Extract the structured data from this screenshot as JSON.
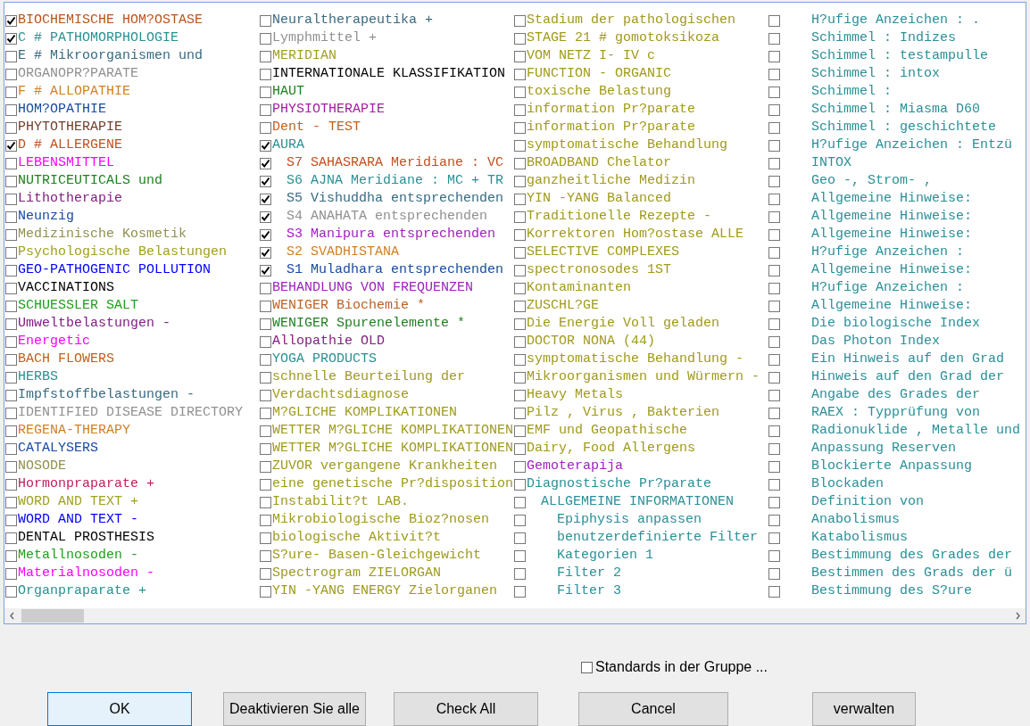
{
  "list": {
    "items": [
      {
        "text": "BIOCHEMISCHE HOM?OSTASE",
        "checked": true,
        "color": "#b8541a"
      },
      {
        "text": "C # PATHOMORPHOLOGIE",
        "checked": true,
        "color": "#2a9090"
      },
      {
        "text": "E # Mikroorganismen und",
        "checked": false,
        "color": "#3a6a80"
      },
      {
        "text": "ORGANOPR?PARATE",
        "checked": false,
        "color": "#909090"
      },
      {
        "text": "F # ALLOPATHIE",
        "checked": false,
        "color": "#d08020"
      },
      {
        "text": "HOM?OPATHIE",
        "checked": false,
        "color": "#1a4aa0"
      },
      {
        "text": "PHYTOTHERAPIE",
        "checked": false,
        "color": "#704030"
      },
      {
        "text": "D # ALLERGENE",
        "checked": true,
        "color": "#c05020"
      },
      {
        "text": "LEBENSMITTEL",
        "checked": false,
        "color": "#ff00ff"
      },
      {
        "text": "NUTRICEUTICALS und",
        "checked": false,
        "color": "#208020"
      },
      {
        "text": "Lithotherapie",
        "checked": false,
        "color": "#802080"
      },
      {
        "text": "Neunzig",
        "checked": false,
        "color": "#1a4aa1"
      },
      {
        "text": "Medizinische Kosmetik",
        "checked": false,
        "color": "#909050"
      },
      {
        "text": "Psychologische Belastungen",
        "checked": false,
        "color": "#a0a020"
      },
      {
        "text": "GEO-PATHOGENIC POLLUTION",
        "checked": false,
        "color": "#0000ff"
      },
      {
        "text": "VACCINATIONS",
        "checked": false,
        "color": "#000000"
      },
      {
        "text": "SCHUESSLER SALT",
        "checked": false,
        "color": "#20a020"
      },
      {
        "text": "Umweltbelastungen -",
        "checked": false,
        "color": "#802081"
      },
      {
        "text": "Energetic",
        "checked": false,
        "color": "#ff00fe"
      },
      {
        "text": "BACH FLOWERS",
        "checked": false,
        "color": "#c06020"
      },
      {
        "text": "HERBS",
        "checked": false,
        "color": "#2a9091"
      },
      {
        "text": "Impfstoffbelastungen -",
        "checked": false,
        "color": "#3a6a81"
      },
      {
        "text": "IDENTIFIED DISEASE DIRECTORY",
        "checked": false,
        "color": "#909091"
      },
      {
        "text": "REGENA-THERAPY",
        "checked": false,
        "color": "#d08021"
      },
      {
        "text": "CATALYSERS",
        "checked": false,
        "color": "#1a4aa2"
      },
      {
        "text": "NOSODE",
        "checked": false,
        "color": "#909051"
      },
      {
        "text": "Hormonpraparate +",
        "checked": false,
        "color": "#c02060"
      },
      {
        "text": "WORD AND TEXT +",
        "checked": false,
        "color": "#a0a021"
      },
      {
        "text": "WORD AND TEXT -",
        "checked": false,
        "color": "#0000fe"
      },
      {
        "text": "DENTAL PROSTHESIS",
        "checked": false,
        "color": "#000001"
      },
      {
        "text": "Metallnosoden -",
        "checked": false,
        "color": "#20a021"
      },
      {
        "text": "Materialnosoden -",
        "checked": false,
        "color": "#fe00ff"
      },
      {
        "text": "Organpraparate +",
        "checked": false,
        "color": "#2a9092"
      },
      {
        "text": "Neuraltherapeutika +",
        "checked": false,
        "color": "#3a6a82"
      },
      {
        "text": "Lymphmittel +",
        "checked": false,
        "color": "#909092"
      },
      {
        "text": "MERIDIAN",
        "checked": false,
        "color": "#a0a022"
      },
      {
        "text": "INTERNATIONALE KLASSIFIKATION",
        "checked": false,
        "color": "#000002"
      },
      {
        "text": "HAUT",
        "checked": false,
        "color": "#208021"
      },
      {
        "text": "PHYSIOTHERAPIE",
        "checked": false,
        "color": "#a020a0"
      },
      {
        "text": "Dent - TEST",
        "checked": false,
        "color": "#c06021"
      },
      {
        "text": "AURA",
        "checked": true,
        "color": "#2a9093",
        "children": [
          {
            "text": "S7 SAHASRARA Meridiane : VC",
            "checked": true,
            "color": "#c05021"
          },
          {
            "text": "S6 AJNA Meridiane : MC + TR",
            "checked": true,
            "color": "#2a9094"
          },
          {
            "text": "S5 Vishuddha entsprechenden",
            "checked": true,
            "color": "#3a6a83"
          },
          {
            "text": "S4 ANAHATA entsprechenden",
            "checked": true,
            "color": "#909093"
          },
          {
            "text": "S3 Manipura entsprechenden",
            "checked": true,
            "color": "#a020c0"
          },
          {
            "text": "S2 SVADHISTANA",
            "checked": true,
            "color": "#d08022"
          },
          {
            "text": "S1 Muladhara entsprechenden",
            "checked": true,
            "color": "#1a4aa3"
          }
        ]
      },
      {
        "text": "BEHANDLUNG VON FREQUENZEN",
        "checked": false,
        "color": "#a020c1"
      },
      {
        "text": "WENIGER Biochemie *",
        "checked": false,
        "color": "#c06022"
      },
      {
        "text": "WENIGER Spurenelemente *",
        "checked": false,
        "color": "#208022"
      },
      {
        "text": "Allopathie OLD",
        "checked": false,
        "color": "#802082"
      },
      {
        "text": "YOGA PRODUCTS",
        "checked": false,
        "color": "#2a9095"
      },
      {
        "text": "schnelle Beurteilung der",
        "checked": false,
        "color": "#a09a1c"
      },
      {
        "text": "Verdachtsdiagnose",
        "checked": false,
        "color": "#a09a1c"
      },
      {
        "text": "M?GLICHE KOMPLIKATIONEN",
        "checked": false,
        "color": "#a09a1c"
      },
      {
        "text": "WETTER M?GLICHE KOMPLIKATIONEN",
        "checked": false,
        "color": "#a09a1c"
      },
      {
        "text": "WETTER M?GLICHE KOMPLIKATIONEN",
        "checked": false,
        "color": "#a09a1c"
      },
      {
        "text": "ZUVOR vergangene Krankheiten",
        "checked": false,
        "color": "#a09a1c"
      },
      {
        "text": "eine genetische Pr?disposition",
        "checked": false,
        "color": "#a09a1c"
      },
      {
        "text": "Instabilit?t LAB.",
        "checked": false,
        "color": "#a09a1c"
      },
      {
        "text": "Mikrobiologische Bioz?nosen",
        "checked": false,
        "color": "#a09a1c"
      },
      {
        "text": "biologische Aktivit?t",
        "checked": false,
        "color": "#a09a1c"
      },
      {
        "text": "S?ure- Basen-Gleichgewicht",
        "checked": false,
        "color": "#a09a1c"
      },
      {
        "text": "Spectrogram ZIELORGAN",
        "checked": false,
        "color": "#a09a1c"
      },
      {
        "text": "YIN -YANG ENERGY Zielorganen",
        "checked": false,
        "color": "#a09a1c"
      },
      {
        "text": "Stadium der pathologischen",
        "checked": false,
        "color": "#a09a1c"
      },
      {
        "text": "STAGE 21 # gomotoksikoza",
        "checked": false,
        "color": "#a09a1c"
      },
      {
        "text": "VOM NETZ I- IV c",
        "checked": false,
        "color": "#a09a1c"
      },
      {
        "text": "FUNCTION - ORGANIC",
        "checked": false,
        "color": "#a09a1c"
      },
      {
        "text": "toxische Belastung",
        "checked": false,
        "color": "#a09a1c"
      },
      {
        "text": "information Pr?parate",
        "checked": false,
        "color": "#a09a1c"
      },
      {
        "text": "information Pr?parate",
        "checked": false,
        "color": "#a09a1c"
      },
      {
        "text": "symptomatische Behandlung",
        "checked": false,
        "color": "#a09a1c"
      },
      {
        "text": "BROADBAND Chelator",
        "checked": false,
        "color": "#a09a1c"
      },
      {
        "text": "ganzheitliche Medizin",
        "checked": false,
        "color": "#a09a1c"
      },
      {
        "text": "YIN -YANG Balanced",
        "checked": false,
        "color": "#a09a1c"
      },
      {
        "text": "Traditionelle Rezepte -",
        "checked": false,
        "color": "#a09a1c"
      },
      {
        "text": "Korrektoren Hom?ostase ALLE",
        "checked": false,
        "color": "#a09a1c"
      },
      {
        "text": "SELECTIVE COMPLEXES",
        "checked": false,
        "color": "#a09a1c"
      },
      {
        "text": "spectronosodes 1ST",
        "checked": false,
        "color": "#a09a1c"
      },
      {
        "text": "Kontaminanten",
        "checked": false,
        "color": "#a09a1c"
      },
      {
        "text": "ZUSCHL?GE",
        "checked": false,
        "color": "#a09a1c"
      },
      {
        "text": "Die Energie Voll geladen",
        "checked": false,
        "color": "#a09a1c"
      },
      {
        "text": "DOCTOR NONA (44)",
        "checked": false,
        "color": "#a09a1c"
      },
      {
        "text": "symptomatische Behandlung -",
        "checked": false,
        "color": "#a09a1c"
      },
      {
        "text": "Mikroorganismen und Würmern -",
        "checked": false,
        "color": "#a09a1c"
      },
      {
        "text": "Heavy Metals",
        "checked": false,
        "color": "#a09a1c"
      },
      {
        "text": "Pilz , Virus , Bakterien",
        "checked": false,
        "color": "#a09a1c"
      },
      {
        "text": "EMF und Geopathische",
        "checked": false,
        "color": "#a09a1c"
      },
      {
        "text": "Dairy, Food Allergens",
        "checked": false,
        "color": "#a09a1c"
      },
      {
        "text": "Gemoterapija",
        "checked": false,
        "color": "#a020c2"
      },
      {
        "text": "Diagnostische Pr?parate",
        "checked": false,
        "color": "#2a9096",
        "children": [
          {
            "text": "ALLGEMEINE INFORMATIONEN",
            "checked": false,
            "color": "#2a9097",
            "children": [
              {
                "text": "Epiphysis anpassen",
                "checked": false,
                "color": "#2a9098"
              },
              {
                "text": "benutzerdefinierte Filter",
                "checked": false,
                "color": "#2a9098"
              },
              {
                "text": "Kategorien 1",
                "checked": false,
                "color": "#2a9098"
              },
              {
                "text": "Filter 2",
                "checked": false,
                "color": "#2a9098"
              },
              {
                "text": "Filter 3",
                "checked": false,
                "color": "#2a9098"
              },
              {
                "text": "H?ufige Anzeichen : .",
                "checked": false,
                "color": "#2a9098"
              },
              {
                "text": "Schimmel : Indizes",
                "checked": false,
                "color": "#2a9098"
              },
              {
                "text": "Schimmel : testampulle",
                "checked": false,
                "color": "#2a9098"
              },
              {
                "text": "Schimmel : intox",
                "checked": false,
                "color": "#2a9098"
              },
              {
                "text": "Schimmel :",
                "checked": false,
                "color": "#2a9098"
              },
              {
                "text": "Schimmel : Miasma D60",
                "checked": false,
                "color": "#2a9098"
              },
              {
                "text": "Schimmel : geschichtete",
                "checked": false,
                "color": "#2a9098"
              },
              {
                "text": "H?ufige Anzeichen : Entzü",
                "checked": false,
                "color": "#2a9098"
              },
              {
                "text": "INTOX",
                "checked": false,
                "color": "#2a9098"
              },
              {
                "text": "Geo -, Strom- ,",
                "checked": false,
                "color": "#2a9098"
              },
              {
                "text": "Allgemeine Hinweise:",
                "checked": false,
                "color": "#2a9098"
              },
              {
                "text": "Allgemeine Hinweise:",
                "checked": false,
                "color": "#2a9098"
              },
              {
                "text": "Allgemeine Hinweise:",
                "checked": false,
                "color": "#2a9098"
              },
              {
                "text": "H?ufige Anzeichen :",
                "checked": false,
                "color": "#2a9098"
              },
              {
                "text": "Allgemeine Hinweise:",
                "checked": false,
                "color": "#2a9098"
              },
              {
                "text": "H?ufige Anzeichen :",
                "checked": false,
                "color": "#2a9098"
              },
              {
                "text": "Allgemeine Hinweise:",
                "checked": false,
                "color": "#2a9098"
              },
              {
                "text": "Die biologische Index",
                "checked": false,
                "color": "#2a9098"
              },
              {
                "text": "Das Photon Index",
                "checked": false,
                "color": "#2a9098"
              },
              {
                "text": "Ein Hinweis auf den Grad",
                "checked": false,
                "color": "#2a9098"
              },
              {
                "text": "Hinweis auf den Grad der",
                "checked": false,
                "color": "#2a9098"
              },
              {
                "text": "Angabe des Grades der",
                "checked": false,
                "color": "#2a9098"
              },
              {
                "text": "RAEX : Typprüfung von",
                "checked": false,
                "color": "#2a9098"
              },
              {
                "text": "Radionuklide , Metalle und",
                "checked": false,
                "color": "#2a9098"
              },
              {
                "text": "Anpassung Reserven",
                "checked": false,
                "color": "#2a9098"
              },
              {
                "text": "Blockierte Anpassung",
                "checked": false,
                "color": "#2a9098"
              },
              {
                "text": "Blockaden",
                "checked": false,
                "color": "#2a9098"
              },
              {
                "text": "Definition von",
                "checked": false,
                "color": "#2a9098"
              },
              {
                "text": "Anabolismus",
                "checked": false,
                "color": "#2a9098"
              },
              {
                "text": "Katabolismus",
                "checked": false,
                "color": "#2a9098"
              },
              {
                "text": "Bestimmung des Grades der",
                "checked": false,
                "color": "#2a9098"
              },
              {
                "text": "Bestimmen des Grads der ü",
                "checked": false,
                "color": "#2a9098"
              },
              {
                "text": "Bestimmung des S?ure",
                "checked": false,
                "color": "#2a9098"
              }
            ]
          }
        ]
      }
    ]
  },
  "group_option": {
    "label": "Standards in der Gruppe ...",
    "checked": false
  },
  "buttons": [
    {
      "label": "OK",
      "default": true
    },
    {
      "label": "Deaktivieren Sie alle",
      "default": false
    },
    {
      "label": "Check All",
      "default": false
    },
    {
      "label": "Cancel",
      "default": false
    },
    {
      "label": "verwalten",
      "default": false
    }
  ]
}
